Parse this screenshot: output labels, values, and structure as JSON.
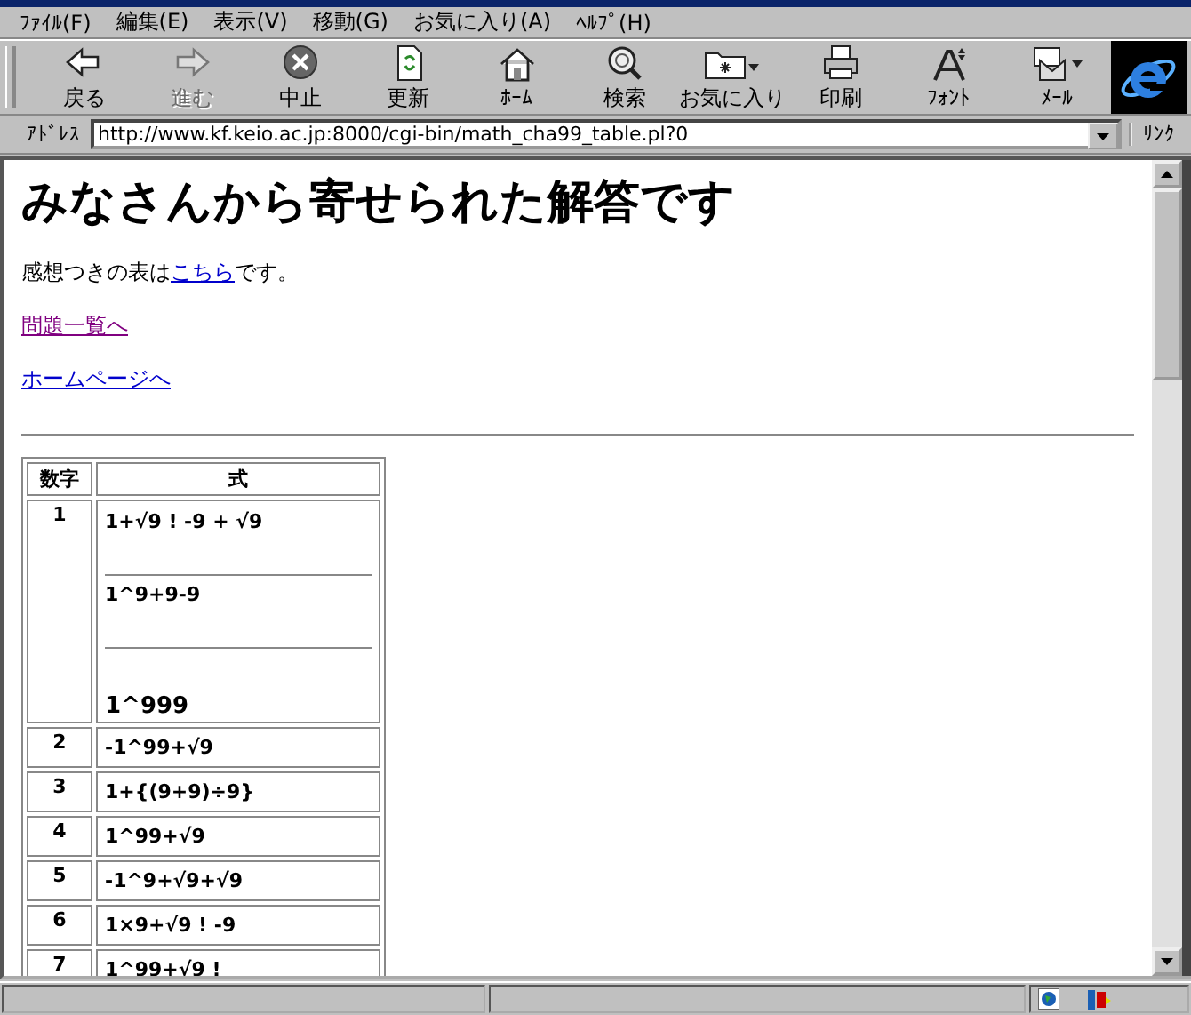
{
  "menu": [
    "ﾌｧｲﾙ(F)",
    "編集(E)",
    "表示(V)",
    "移動(G)",
    "お気に入り(A)",
    "ﾍﾙﾌﾟ(H)"
  ],
  "toolbar": [
    {
      "label": "戻る",
      "disabled": false
    },
    {
      "label": "進む",
      "disabled": true
    },
    {
      "label": "中止",
      "disabled": false
    },
    {
      "label": "更新",
      "disabled": false
    },
    {
      "label": "ﾎｰﾑ",
      "disabled": false
    },
    {
      "label": "検索",
      "disabled": false
    },
    {
      "label": "お気に入り",
      "disabled": false
    },
    {
      "label": "印刷",
      "disabled": false
    },
    {
      "label": "ﾌｫﾝﾄ",
      "disabled": false
    },
    {
      "label": "ﾒｰﾙ",
      "disabled": false
    }
  ],
  "address": {
    "label": "ｱﾄﾞﾚｽ",
    "value": "http://www.kf.keio.ac.jp:8000/cgi-bin/math_cha99_table.pl?0"
  },
  "links_label": "ﾘﾝｸ",
  "page": {
    "heading": "みなさんから寄せられた解答です",
    "intro": {
      "before": "感想つきの表は",
      "link": "こちら",
      "after": "です。"
    },
    "links": [
      {
        "text": "問題一覧へ",
        "visited": true
      },
      {
        "text": "ホームページへ",
        "visited": false
      }
    ],
    "table": {
      "columns": [
        "数字",
        "式"
      ],
      "rows": [
        {
          "number": "1",
          "formulas": [
            "1+√9 ! -9 + √9",
            "1^9+9-9",
            "1^999"
          ]
        },
        {
          "number": "2",
          "formulas": [
            "-1^99+√9"
          ]
        },
        {
          "number": "3",
          "formulas": [
            "1+{(9+9)÷9}"
          ]
        },
        {
          "number": "4",
          "formulas": [
            "1^99+√9"
          ]
        },
        {
          "number": "5",
          "formulas": [
            "-1^9+√9+√9"
          ]
        },
        {
          "number": "6",
          "formulas": [
            "1×9+√9 ! -9"
          ]
        },
        {
          "number": "7",
          "formulas": [
            "1^99+√9 !"
          ]
        }
      ]
    }
  }
}
